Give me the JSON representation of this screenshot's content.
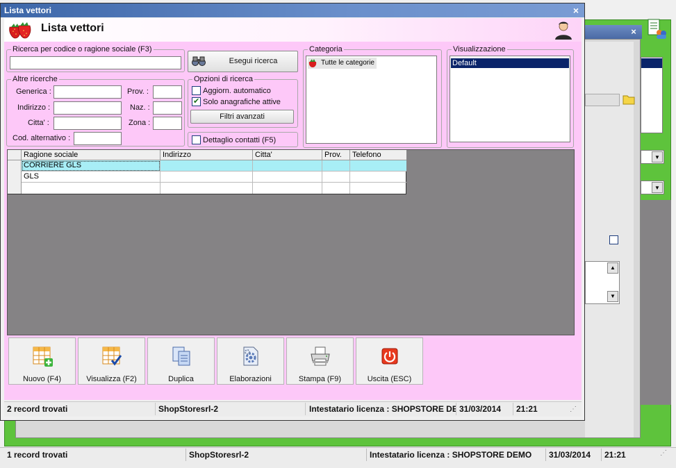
{
  "window": {
    "title": "Lista vettori",
    "close_glyph": "×",
    "heading": "Lista vettori",
    "icons": {
      "app": "strawberry-icon",
      "user": "user-icon"
    }
  },
  "search": {
    "group_label": "Ricerca per codice o ragione sociale (F3)",
    "value": "",
    "execute_label": "Esegui ricerca"
  },
  "other_searches": {
    "group_label": "Altre ricerche",
    "generica_label": "Generica :",
    "indirizzo_label": "Indirizzo :",
    "citta_label": "Citta' :",
    "cod_alt_label": "Cod. alternativo :",
    "prov_label": "Prov. :",
    "naz_label": "Naz. :",
    "zona_label": "Zona :"
  },
  "search_options": {
    "group_label": "Opzioni di ricerca",
    "auto_update_label": "Aggiorn. automatico",
    "auto_update_checked": false,
    "active_only_label": "Solo anagrafiche attive",
    "active_only_checked": true,
    "advanced_filters_label": "Filtri avanzati"
  },
  "contact_detail": {
    "label": "Dettaglio contatti (F5)",
    "checked": false
  },
  "category": {
    "group_label": "Categoria",
    "items": [
      {
        "label": "Tutte le categorie"
      }
    ]
  },
  "visualization": {
    "group_label": "Visualizzazione",
    "items": [
      {
        "label": "Default",
        "selected": true
      }
    ]
  },
  "grid": {
    "columns": [
      "Ragione sociale",
      "Indirizzo",
      "Citta'",
      "Prov.",
      "Telefono"
    ],
    "rows": [
      {
        "ragione_sociale": "CORRIERE GLS",
        "indirizzo": "",
        "citta": "",
        "prov": "",
        "telefono": ""
      },
      {
        "ragione_sociale": "GLS",
        "indirizzo": "",
        "citta": "",
        "prov": "",
        "telefono": ""
      },
      {
        "ragione_sociale": "",
        "indirizzo": "",
        "citta": "",
        "prov": "",
        "telefono": ""
      }
    ]
  },
  "toolbar": {
    "new_label": "Nuovo (F4)",
    "view_label": "Visualizza (F2)",
    "duplicate_label": "Duplica",
    "process_label": "Elaborazioni",
    "print_label": "Stampa (F9)",
    "exit_label": "Uscita (ESC)"
  },
  "status": {
    "records": "2 record trovati",
    "company": "ShopStoresrl-2",
    "license": "Intestatario licenza : SHOPSTORE DEMO",
    "date": "31/03/2014",
    "time": "21:21"
  },
  "background_window": {
    "close_glyph": "×",
    "status": {
      "records": "1 record trovati",
      "company": "ShopStoresrl-2",
      "license": "Intestatario licenza : SHOPSTORE DEMO",
      "date": "31/03/2014",
      "time": "21:21"
    }
  },
  "colors": {
    "title_bar": "#3c66a8",
    "form_background": "#fdc8f8",
    "grid_selected_row": "#a8eef6",
    "grid_empty_area": "#858385",
    "background_accent": "#5ec33c",
    "selection": "#0a246a"
  }
}
